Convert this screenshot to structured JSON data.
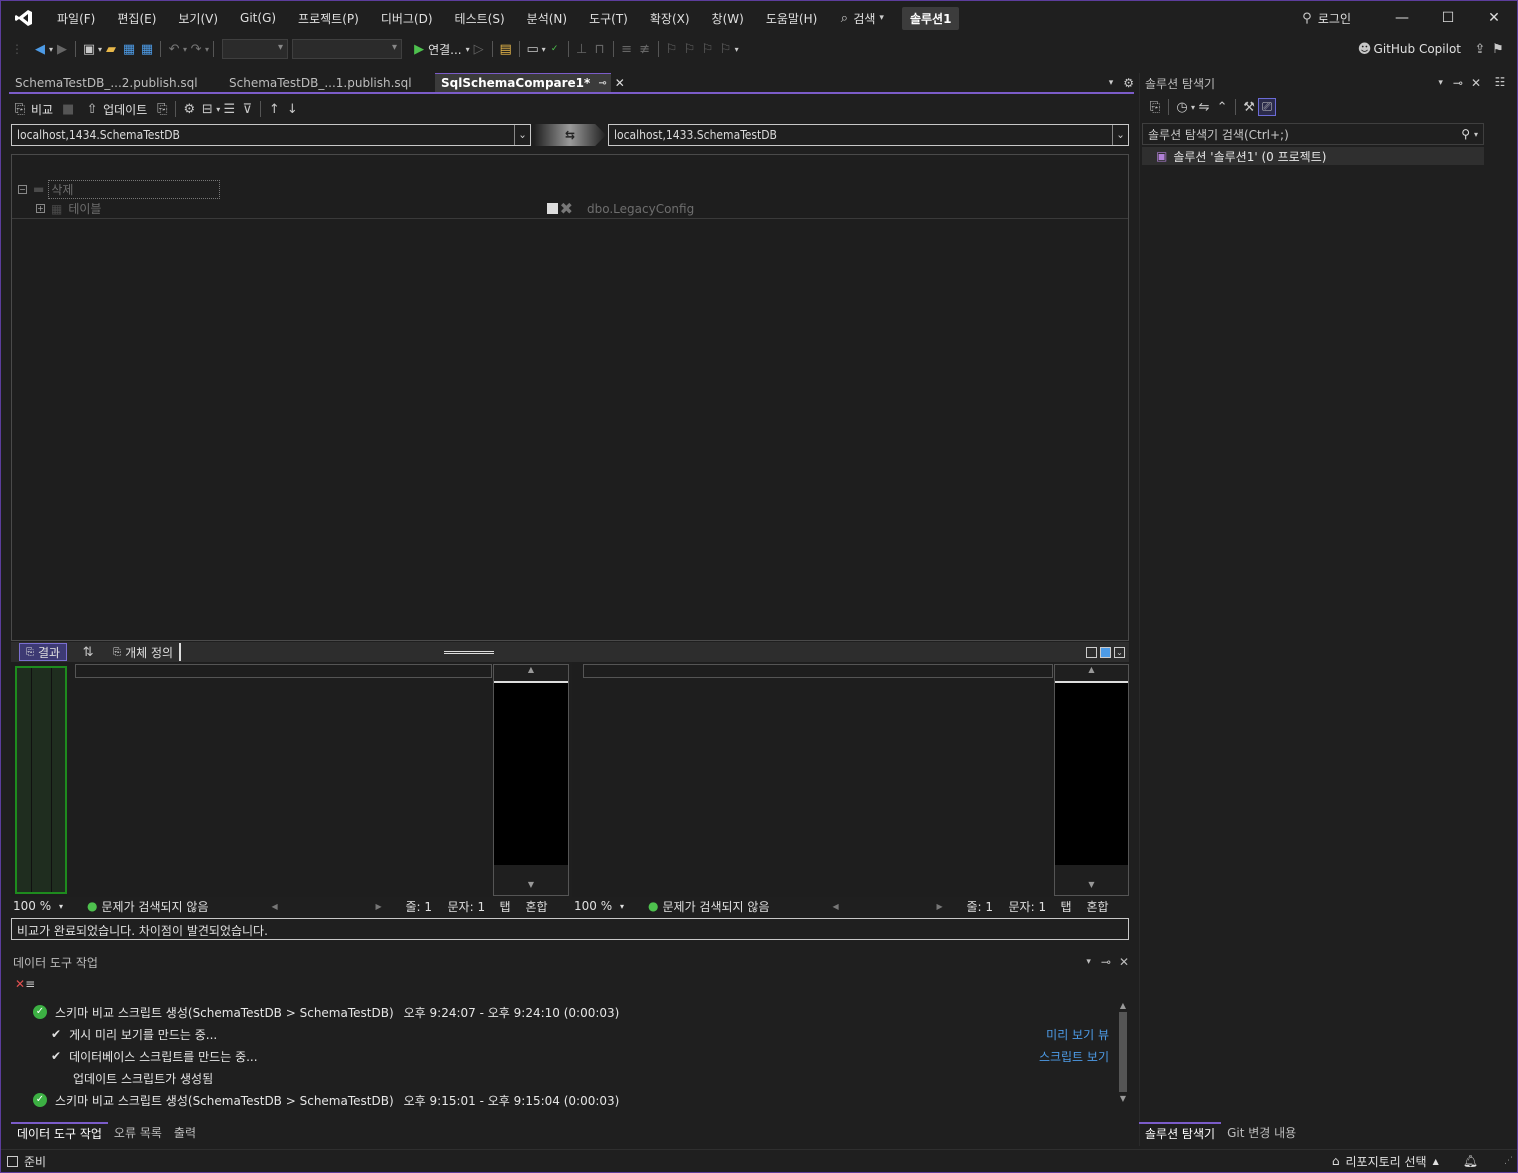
{
  "titlebar": {
    "menus": [
      "파일(F)",
      "편집(E)",
      "보기(V)",
      "Git(G)",
      "프로젝트(P)",
      "디버그(D)",
      "테스트(S)",
      "분석(N)",
      "도구(T)",
      "확장(X)",
      "창(W)",
      "도움말(H)"
    ],
    "search_label": "검색",
    "solution_name": "솔루션1",
    "login_label": "로그인"
  },
  "toolbar": {
    "connect_label": "연결...",
    "copilot_label": "GitHub Copilot"
  },
  "tabs": [
    {
      "label": "SchemaTestDB_...2.publish.sql"
    },
    {
      "label": "SchemaTestDB_...1.publish.sql"
    },
    {
      "label": "SqlSchemaCompare1*"
    }
  ],
  "compare": {
    "compare_label": "비교",
    "update_label": "업데이트",
    "source_db": "localhost,1434.SchemaTestDB",
    "target_db": "localhost,1433.SchemaTestDB",
    "tree": {
      "group_label": "삭제",
      "category_label": "테이블",
      "object_name": "dbo.LegacyConfig"
    }
  },
  "lower": {
    "tab_results": "결과",
    "tab_object_def": "개체 정의",
    "left_status": {
      "zoom": "100 %",
      "issues": "문제가 검색되지 않음",
      "line": "줄: 1",
      "char": "문자: 1",
      "tab": "탭",
      "mode": "혼합"
    },
    "right_status": {
      "zoom": "100 %",
      "issues": "문제가 검색되지 않음",
      "line": "줄: 1",
      "char": "문자: 1",
      "tab": "탭",
      "mode": "혼합"
    }
  },
  "message": "비교가 완료되었습니다. 차이점이 발견되었습니다.",
  "data_tools": {
    "title": "데이터 도구 작업",
    "tasks": [
      {
        "type": "done",
        "text": "스키마 비교 스크립트 생성(SchemaTestDB > SchemaTestDB)",
        "time": "오후 9:24:07 - 오후 9:24:10 (0:00:03)",
        "link": ""
      },
      {
        "type": "check",
        "text": "게시 미리 보기를 만드는 중...",
        "time": "",
        "link": "미리 보기 뷰"
      },
      {
        "type": "check",
        "text": "데이터베이스 스크립트를 만드는 중...",
        "time": "",
        "link": "스크립트 보기"
      },
      {
        "type": "plain",
        "text": "업데이트 스크립트가 생성됨",
        "time": "",
        "link": ""
      },
      {
        "type": "done",
        "text": "스키마 비교 스크립트 생성(SchemaTestDB > SchemaTestDB)",
        "time": "오후 9:15:01 - 오후 9:15:04 (0:00:03)",
        "link": ""
      }
    ],
    "bottom_tabs": [
      "데이터 도구 작업",
      "오류 목록",
      "출력"
    ]
  },
  "solution_explorer": {
    "title": "솔루션 탐색기",
    "search_placeholder": "솔루션 탐색기 검색(Ctrl+;)",
    "item": "솔루션 '솔루션1' (0 프로젝트)",
    "bottom_tabs": [
      "솔루션 탐색기",
      "Git 변경 내용"
    ]
  },
  "statusbar": {
    "ready": "준비",
    "repo": "리포지토리 선택"
  }
}
